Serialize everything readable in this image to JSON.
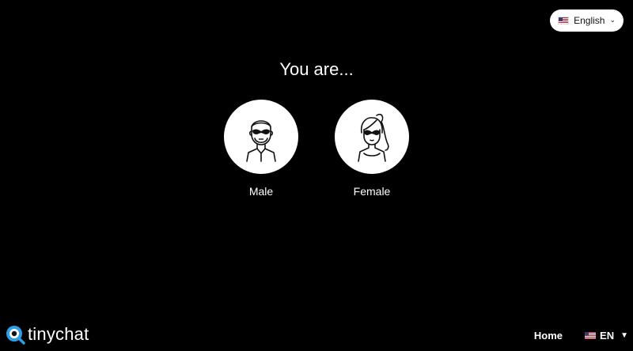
{
  "language_selector": {
    "label": "English",
    "flag_icon": "us-flag-icon",
    "chevron_icon": "chevron-down-icon"
  },
  "heading": "You are...",
  "choices": [
    {
      "label": "Male",
      "icon": "male-avatar-icon"
    },
    {
      "label": "Female",
      "icon": "female-avatar-icon"
    }
  ],
  "footer": {
    "logo_text": "tinychat",
    "home_label": "Home",
    "lang_code": "EN"
  },
  "colors": {
    "background": "#000000",
    "foreground": "#ffffff",
    "logo_accent": "#2e9fe6"
  }
}
